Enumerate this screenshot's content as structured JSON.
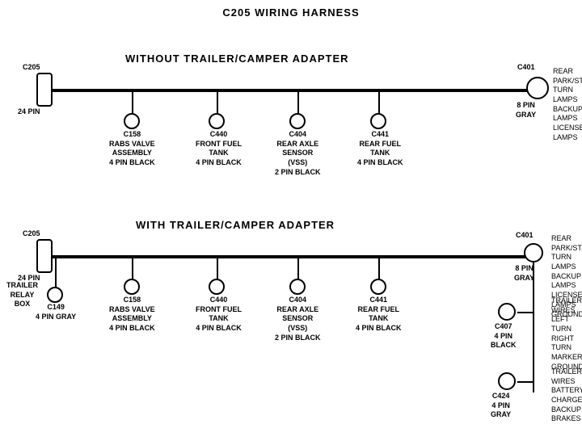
{
  "title": "C205 WIRING HARNESS",
  "section1": {
    "label": "WITHOUT  TRAILER/CAMPER  ADAPTER"
  },
  "section2": {
    "label": "WITH  TRAILER/CAMPER  ADAPTER"
  },
  "connectors_top": [
    {
      "id": "C205_top",
      "label": "C205",
      "sub": "24 PIN",
      "type": "rect"
    },
    {
      "id": "C158_top",
      "label": "C158",
      "sub": "RABS VALVE\nASSEMBLY\n4 PIN BLACK"
    },
    {
      "id": "C440_top",
      "label": "C440",
      "sub": "FRONT FUEL\nTANK\n4 PIN BLACK"
    },
    {
      "id": "C404_top",
      "label": "C404",
      "sub": "REAR AXLE\nSENSOR\n(VSS)\n2 PIN BLACK"
    },
    {
      "id": "C441_top",
      "label": "C441",
      "sub": "REAR FUEL\nTANK\n4 PIN BLACK"
    },
    {
      "id": "C401_top",
      "label": "C401",
      "sub": "8 PIN\nGRAY",
      "right": "REAR PARK/STOP\nTURN LAMPS\nBACKUP LAMPS\nLICENSE LAMPS"
    }
  ],
  "connectors_bottom": [
    {
      "id": "C205_bot",
      "label": "C205",
      "sub": "24 PIN",
      "type": "rect"
    },
    {
      "id": "C149",
      "label": "C149",
      "sub": "4 PIN GRAY",
      "extra": "TRAILER\nRELAY\nBOX"
    },
    {
      "id": "C158_bot",
      "label": "C158",
      "sub": "RABS VALVE\nASSEMBLY\n4 PIN BLACK"
    },
    {
      "id": "C440_bot",
      "label": "C440",
      "sub": "FRONT FUEL\nTANK\n4 PIN BLACK"
    },
    {
      "id": "C404_bot",
      "label": "C404",
      "sub": "REAR AXLE\nSENSOR\n(VSS)\n2 PIN BLACK"
    },
    {
      "id": "C441_bot",
      "label": "C441",
      "sub": "REAR FUEL\nTANK\n4 PIN BLACK"
    },
    {
      "id": "C401_bot",
      "label": "C401",
      "sub": "8 PIN\nGRAY",
      "right": "REAR PARK/STOP\nTURN LAMPS\nBACKUP LAMPS\nLICENSE LAMPS\nGROUND"
    },
    {
      "id": "C407",
      "label": "C407",
      "sub": "4 PIN\nBLACK",
      "right": "TRAILER WIRES\nLEFT TURN\nRIGHT TURN\nMARKER\nGROUND"
    },
    {
      "id": "C424",
      "label": "C424",
      "sub": "4 PIN\nGRAY",
      "right": "TRAILER WIRES\nBATTERY CHARGE\nBACKUP\nBRAKES"
    }
  ]
}
